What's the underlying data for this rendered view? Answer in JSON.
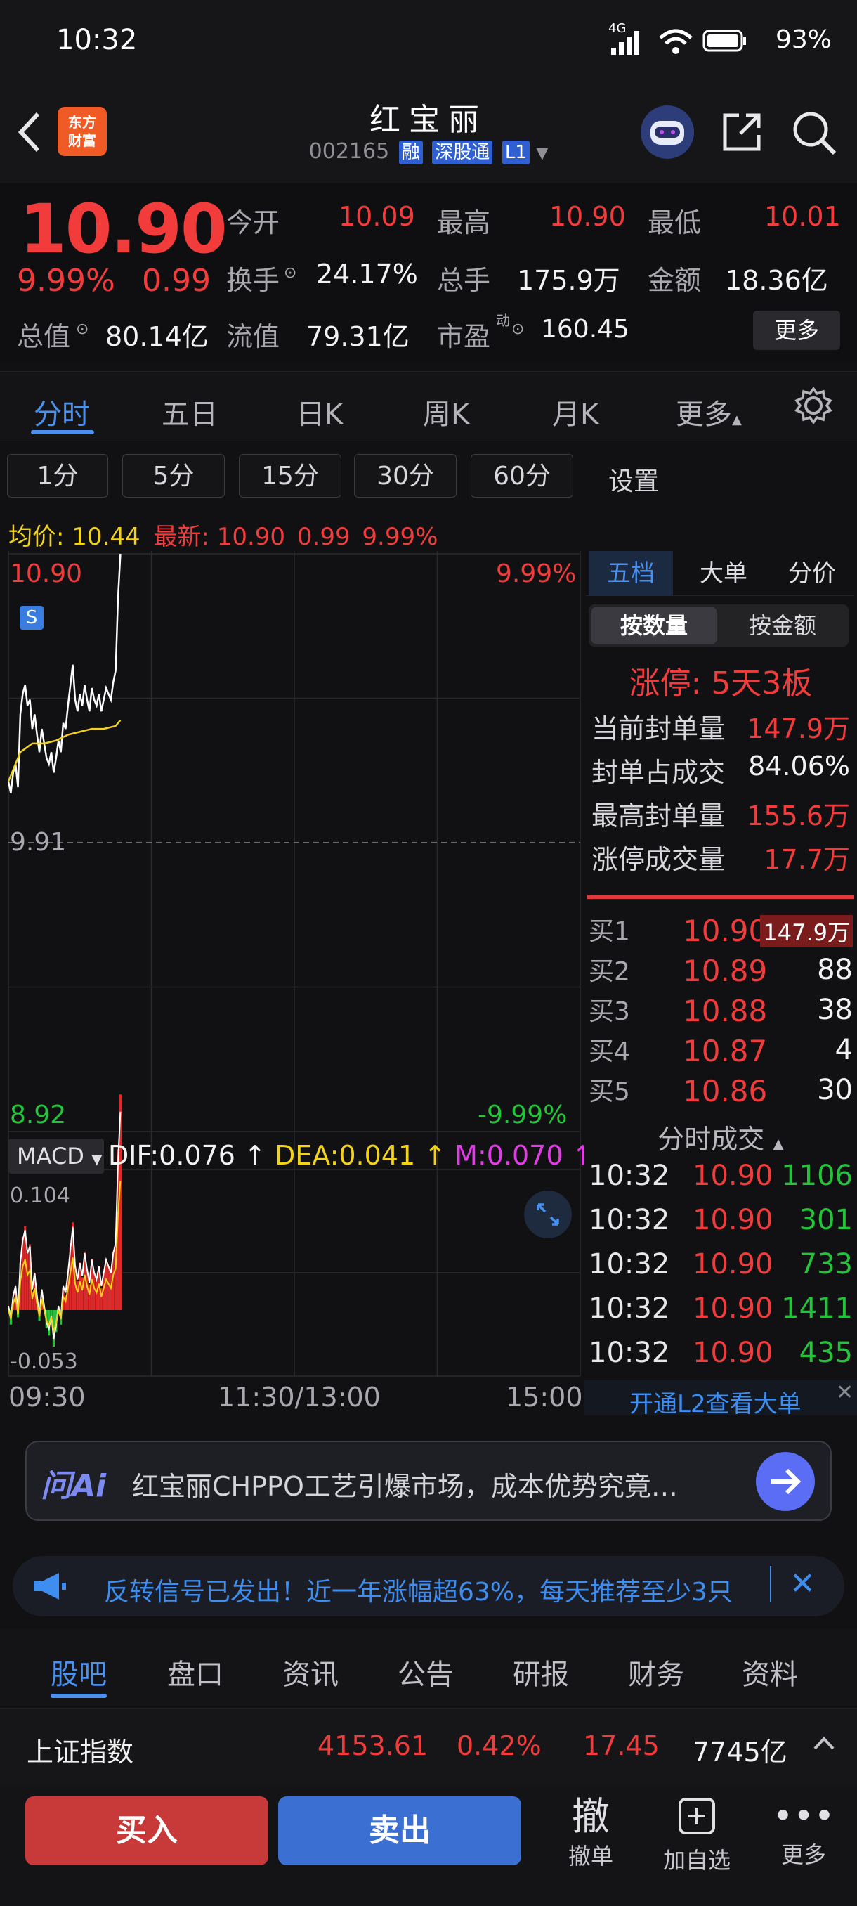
{
  "status_bar": {
    "time": "10:32",
    "network": "4G",
    "battery": "93%"
  },
  "header": {
    "logo_text": [
      "东方",
      "财富"
    ],
    "stock_name": "红宝丽",
    "stock_code": "002165",
    "tags": [
      "融",
      "深股通",
      "L1"
    ]
  },
  "quote": {
    "price": "10.90",
    "change_pct": "9.99%",
    "change": "0.99",
    "open_label": "今开",
    "open": "10.09",
    "high_label": "最高",
    "high": "10.90",
    "low_label": "最低",
    "low": "10.01",
    "turnover_label": "换手",
    "turnover": "24.17%",
    "volume_label": "总手",
    "volume": "175.9万",
    "amount_label": "金额",
    "amount": "18.36亿",
    "total_mv_label": "总值",
    "total_mv": "80.14亿",
    "float_mv_label": "流值",
    "float_mv": "79.31亿",
    "pe_label": "市盈",
    "pe_sup": "动",
    "pe": "160.45",
    "more_label": "更多"
  },
  "period_tabs": [
    "分时",
    "五日",
    "日K",
    "周K",
    "月K",
    "更多"
  ],
  "interval_buttons": [
    "1分",
    "5分",
    "15分",
    "30分",
    "60分"
  ],
  "interval_setting": "设置",
  "legend": {
    "avg_label": "均价:",
    "avg": "10.44",
    "latest_label": "最新:",
    "latest": "10.90",
    "latest_chg": "0.99",
    "latest_pct": "9.99%"
  },
  "price_axis": {
    "top": "10.90",
    "top_pct": "9.99%",
    "mid": "9.91",
    "bottom": "8.92",
    "bottom_pct": "-9.99%"
  },
  "macd": {
    "label": "MACD",
    "dif": "DIF:0.076",
    "dea": "DEA:0.041",
    "m": "M:0.070",
    "axis_top": "0.104",
    "axis_bottom": "-0.053"
  },
  "time_axis": [
    "09:30",
    "11:30/13:00",
    "15:00"
  ],
  "chart_data": {
    "type": "line",
    "title": "",
    "x_range": [
      "09:30",
      "15:00"
    ],
    "ylim": [
      8.92,
      10.9
    ],
    "prev_close": 9.91,
    "series": [
      {
        "name": "最新",
        "x_minutes_from_open": [
          0,
          1,
          2,
          3,
          4,
          5,
          6,
          7,
          8,
          9,
          10,
          11,
          12,
          13,
          14,
          15,
          16,
          17,
          18,
          19,
          20,
          21,
          22,
          23,
          24,
          25,
          26,
          27,
          28,
          29,
          30,
          31,
          32,
          33,
          34,
          35,
          36,
          37,
          38,
          39,
          40,
          41,
          42,
          43,
          44,
          45,
          46,
          47
        ],
        "values": [
          10.12,
          10.08,
          10.15,
          10.18,
          10.1,
          10.35,
          10.42,
          10.45,
          10.38,
          10.4,
          10.3,
          10.35,
          10.28,
          10.22,
          10.3,
          10.25,
          10.2,
          10.18,
          10.22,
          10.15,
          10.2,
          10.26,
          10.22,
          10.32,
          10.3,
          10.38,
          10.45,
          10.52,
          10.4,
          10.36,
          10.42,
          10.38,
          10.45,
          10.4,
          10.36,
          10.44,
          10.4,
          10.38,
          10.42,
          10.36,
          10.4,
          10.44,
          10.42,
          10.4,
          10.46,
          10.5,
          10.75,
          10.9
        ]
      },
      {
        "name": "均价",
        "x_minutes_from_open": [
          0,
          5,
          10,
          15,
          20,
          25,
          30,
          35,
          40,
          45,
          47
        ],
        "values": [
          10.12,
          10.22,
          10.25,
          10.25,
          10.26,
          10.28,
          10.29,
          10.3,
          10.3,
          10.31,
          10.33
        ]
      }
    ]
  },
  "order_panel": {
    "tabs": [
      "五档",
      "大单",
      "分价"
    ],
    "sub_tabs": [
      "按数量",
      "按金额"
    ],
    "limit_up": "涨停: 5天3板",
    "seal_rows": [
      {
        "label": "当前封单量",
        "value": "147.9万"
      },
      {
        "label": "封单占成交",
        "value": "84.06%"
      },
      {
        "label": "最高封单量",
        "value": "155.6万"
      },
      {
        "label": "涨停成交量",
        "value": "17.7万"
      }
    ],
    "bids": [
      {
        "label": "买1",
        "price": "10.90",
        "vol": "147.9万"
      },
      {
        "label": "买2",
        "price": "10.89",
        "vol": "88"
      },
      {
        "label": "买3",
        "price": "10.88",
        "vol": "38"
      },
      {
        "label": "买4",
        "price": "10.87",
        "vol": "4"
      },
      {
        "label": "买5",
        "price": "10.86",
        "vol": "30"
      }
    ],
    "ticks_title": "分时成交",
    "ticks": [
      {
        "time": "10:32",
        "price": "10.90",
        "vol": "1106"
      },
      {
        "time": "10:32",
        "price": "10.90",
        "vol": "301"
      },
      {
        "time": "10:32",
        "price": "10.90",
        "vol": "733"
      },
      {
        "time": "10:32",
        "price": "10.90",
        "vol": "1411"
      },
      {
        "time": "10:32",
        "price": "10.90",
        "vol": "435"
      }
    ],
    "l2_link": "开通L2查看大单"
  },
  "ai": {
    "logo": "问Ai",
    "text": "红宝丽CHPPO工艺引爆市场，成本优势究竟…"
  },
  "promo": {
    "text": "反转信号已发出！近一年涨幅超63%，每天推荐至少3只"
  },
  "info_tabs": [
    "股吧",
    "盘口",
    "资讯",
    "公告",
    "研报",
    "财务",
    "资料"
  ],
  "index_bar": {
    "name": "上证指数",
    "value": "4153.61",
    "pct": "0.42%",
    "chg": "17.45",
    "amount": "7745亿"
  },
  "bottom": {
    "buy": "买入",
    "sell": "卖出",
    "cancel_glyph": "撤",
    "cancel": "撤单",
    "add_fav": "加自选",
    "more": "更多"
  },
  "colors": {
    "up": "#f23b3b",
    "down": "#23c43a",
    "accent": "#4a90ee",
    "avg_line": "#f2d21a",
    "price_line": "#ffffff"
  }
}
